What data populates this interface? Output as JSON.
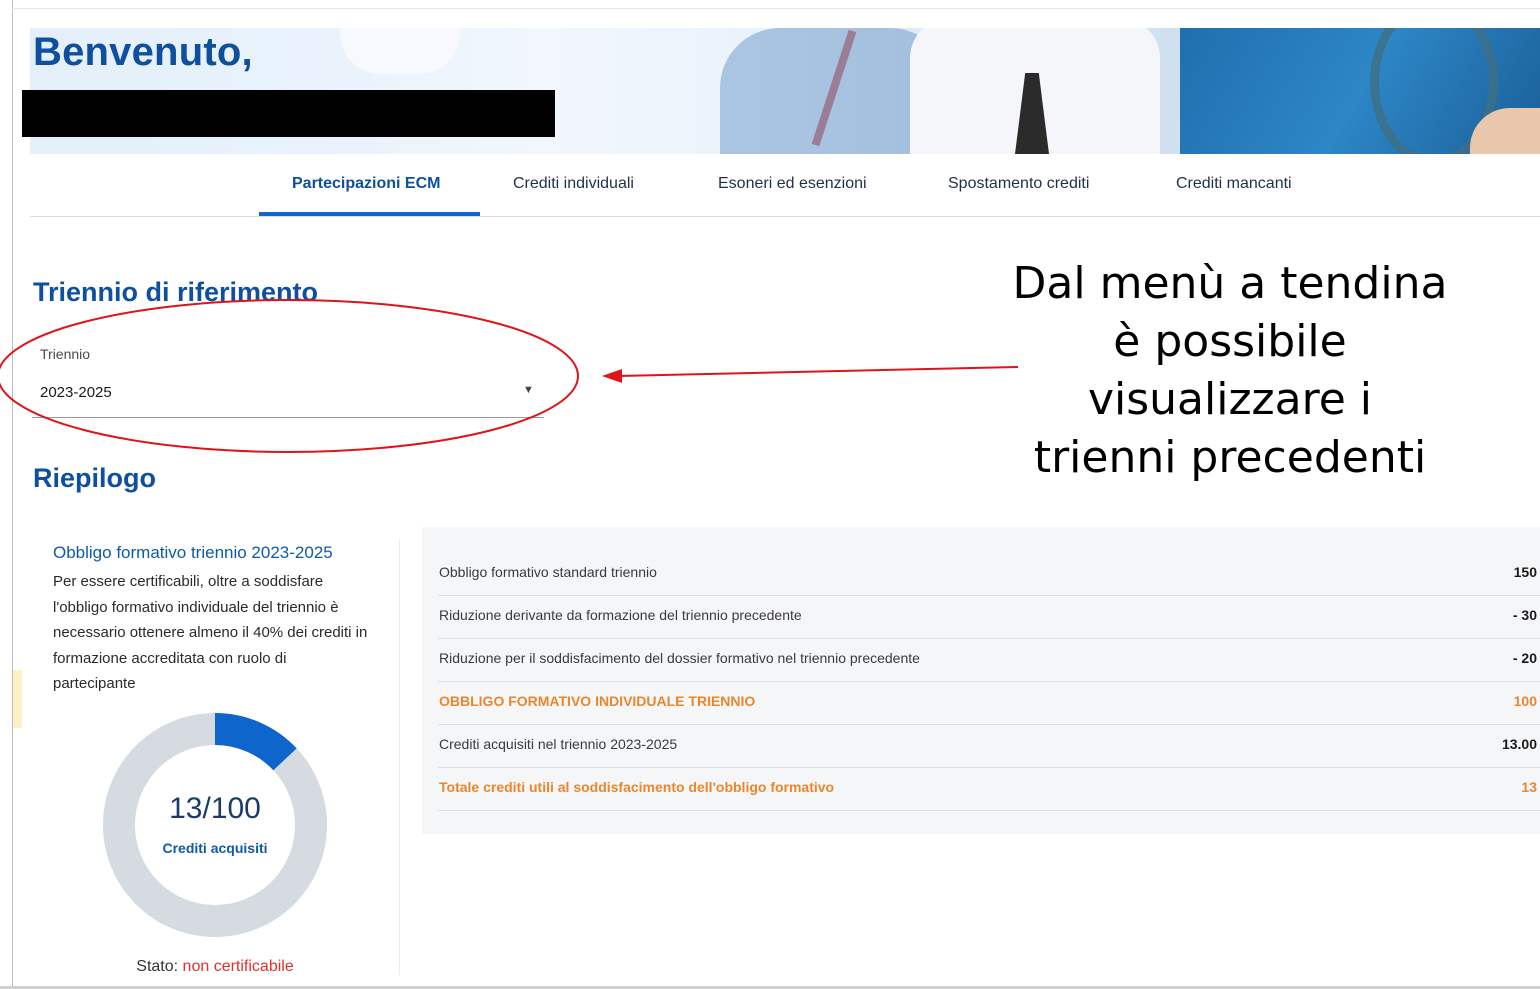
{
  "header": {
    "welcome": "Benvenuto,"
  },
  "tabs": [
    {
      "label": "Partecipazioni ECM",
      "active": true
    },
    {
      "label": "Crediti individuali",
      "active": false
    },
    {
      "label": "Esoneri ed esenzioni",
      "active": false
    },
    {
      "label": "Spostamento crediti",
      "active": false
    },
    {
      "label": "Crediti mancanti",
      "active": false
    }
  ],
  "triennio": {
    "section_title": "Triennio di riferimento",
    "label": "Triennio",
    "value": "2023-2025"
  },
  "annotation": {
    "lines": [
      "Dal menù a tendina",
      "è possibile",
      "visualizzare i",
      "trienni precedenti"
    ]
  },
  "riepilogo": {
    "title": "Riepilogo",
    "obbligo_title": "Obbligo formativo triennio 2023-2025",
    "obbligo_text": "Per essere certificabili, oltre a soddisfare l'obbligo formativo individuale del triennio è necessario ottenere almeno il 40% dei crediti in formazione accreditata con ruolo di partecipante",
    "donut": {
      "acquired": 13,
      "total": 100,
      "value_text": "13/100",
      "label": "Crediti acquisiti"
    },
    "stato_label": "Stato:",
    "stato_value": "non certificabile"
  },
  "table": {
    "rows": [
      {
        "label": "Obbligo formativo standard triennio",
        "value": "150",
        "accent": false
      },
      {
        "label": "Riduzione derivante da formazione del triennio precedente",
        "value": "- 30",
        "accent": false
      },
      {
        "label": "Riduzione per il soddisfacimento del dossier formativo nel triennio precedente",
        "value": "- 20",
        "accent": false
      },
      {
        "label": "OBBLIGO FORMATIVO INDIVIDUALE TRIENNIO",
        "value": "100",
        "accent": true
      },
      {
        "label": "Crediti acquisiti nel triennio 2023-2025",
        "value": "13.00",
        "accent": false
      },
      {
        "label": "Totale crediti utili al soddisfacimento dell'obbligo formativo",
        "value": "13",
        "accent": true
      }
    ]
  },
  "colors": {
    "brand_blue": "#0e4f9e",
    "accent_orange": "#e8872c",
    "status_red": "#e0322e",
    "donut_fill": "#0e66cc",
    "donut_track": "#d5dbe1",
    "annotation_red": "#e0131a"
  }
}
